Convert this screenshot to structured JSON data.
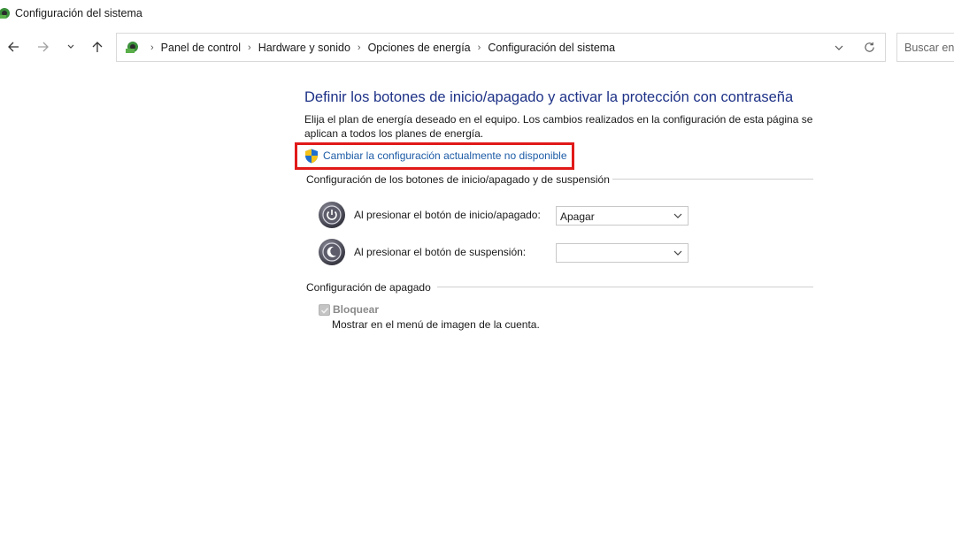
{
  "window": {
    "title": "Configuración del sistema"
  },
  "navigation": {
    "breadcrumbs": [
      "Panel de control",
      "Hardware y sonido",
      "Opciones de energía",
      "Configuración del sistema"
    ],
    "search_placeholder": "Buscar en"
  },
  "main": {
    "title": "Definir los botones de inicio/apagado y activar la protección con contraseña",
    "description": "Elija el plan de energía deseado en el equipo. Los cambios realizados en la configuración de esta página se aplican a todos los planes de energía.",
    "change_settings_link": "Cambiar la configuración actualmente no disponible",
    "power_buttons_section": {
      "header": "Configuración de los botones de inicio/apagado y de suspensión",
      "rows": [
        {
          "label": "Al presionar el botón de inicio/apagado:",
          "value": "Apagar"
        },
        {
          "label": "Al presionar el botón de suspensión:",
          "value": ""
        }
      ]
    },
    "shutdown_section": {
      "header": "Configuración de apagado",
      "options": [
        {
          "label": "Bloquear",
          "description": "Mostrar en el menú de imagen de la cuenta.",
          "checked": true,
          "disabled": true
        }
      ]
    }
  },
  "colors": {
    "title_blue": "#1e3287",
    "link_blue": "#1c5ba6",
    "highlight_red": "#e11919"
  }
}
